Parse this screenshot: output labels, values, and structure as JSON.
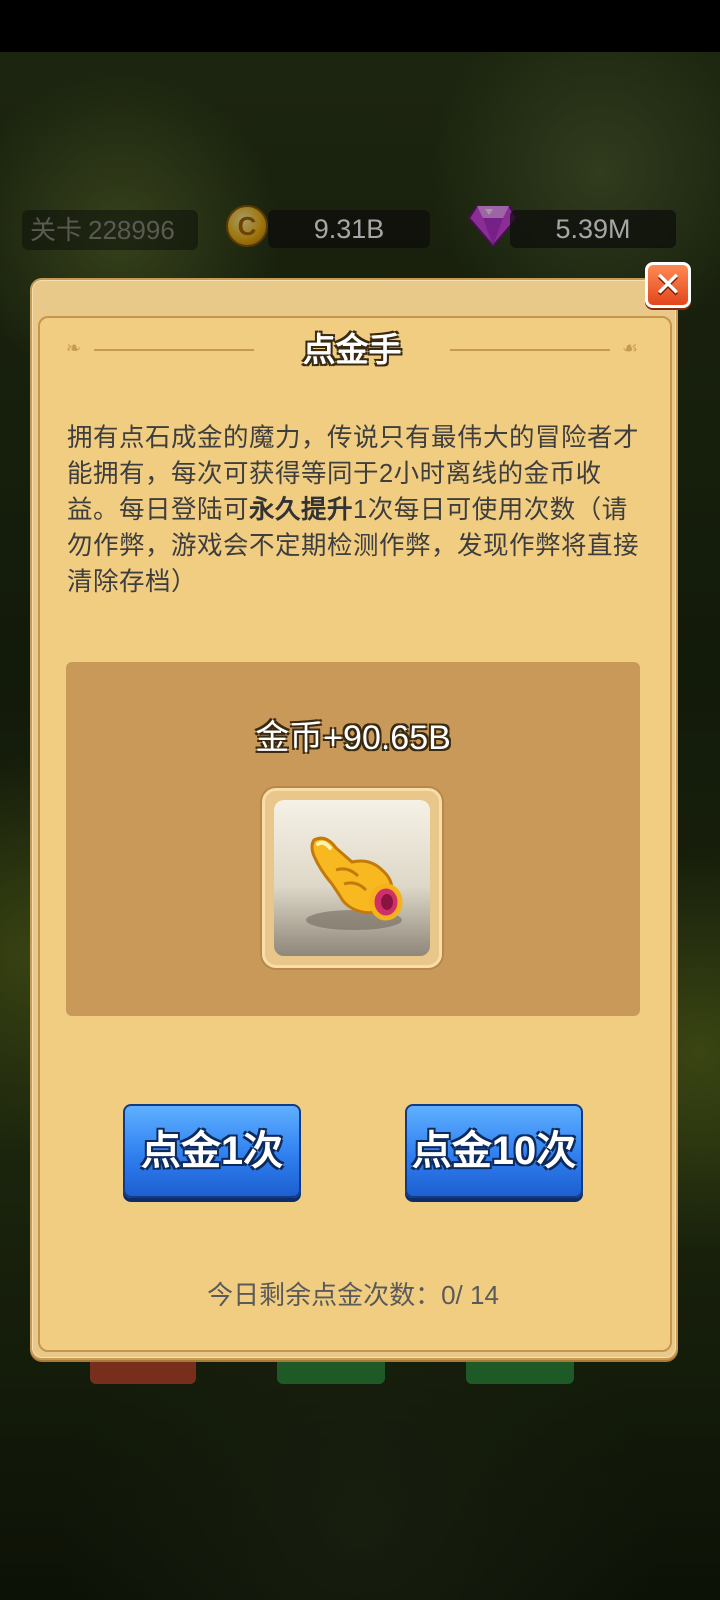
{
  "hud": {
    "level_label": "关卡",
    "level_value": "228996",
    "coins": "9.31B",
    "coin_icon_glyph": "C",
    "gems": "5.39M"
  },
  "dialog": {
    "title": "点金手",
    "description_part1": "拥有点石成金的魔力，传说只有最伟大的冒险者才能拥有，每次可获得等同于2小时离线的金币收益。每日登陆可",
    "description_bold": "永久提升",
    "description_part2": "1次每日可使用次数（请勿作弊，游戏会不定期检测作弊，发现作弊将直接清除存档）",
    "reward_text": "金币+90.65B",
    "item_icon": "pointing-hand-icon",
    "button_once": "点金1次",
    "button_ten": "点金10次",
    "remaining_label": "今日剩余点金次数：",
    "remaining_value": "0/ 14",
    "close_icon": "close-icon"
  },
  "colors": {
    "panel_bg": "#f1cd82",
    "reward_box": "#c9995a",
    "button_blue": "#2f7ff0",
    "close_red": "#e2461c"
  }
}
